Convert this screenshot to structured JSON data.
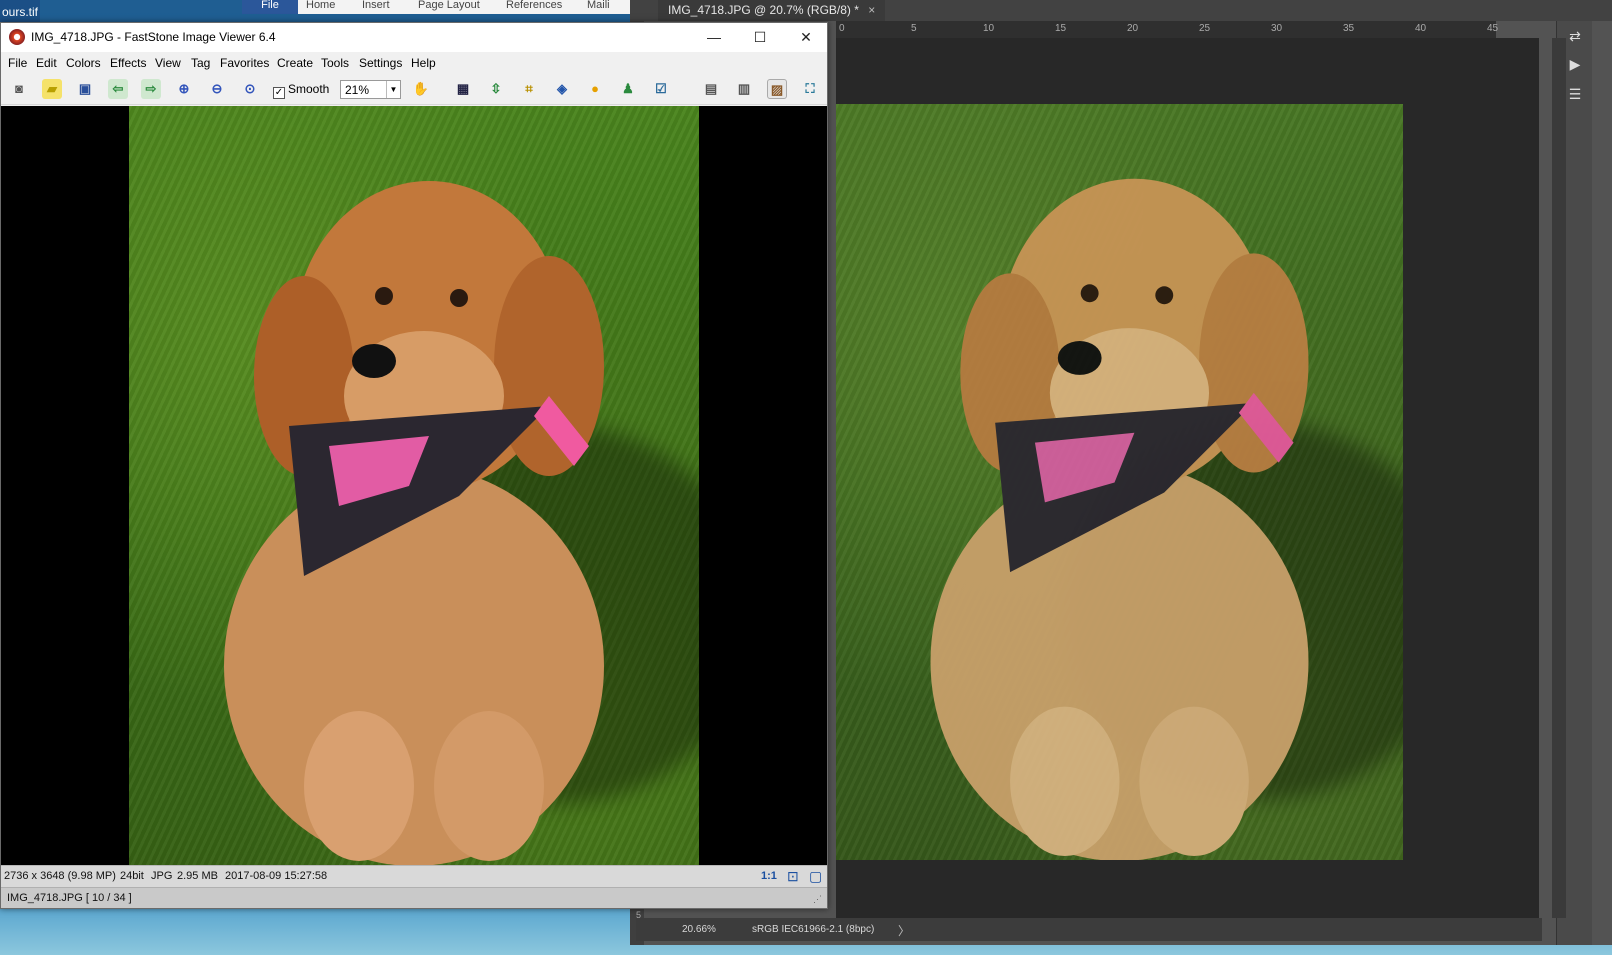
{
  "desktop": {
    "caption": "ours.tif"
  },
  "word": {
    "tabs": [
      "File",
      "Home",
      "Insert",
      "Page Layout",
      "References",
      "Maili"
    ]
  },
  "photoshop": {
    "doc_tab": "IMG_4718.JPG @ 20.7% (RGB/8) *",
    "close": "×",
    "ruler_ticks": [
      "0",
      "5",
      "10",
      "15",
      "20",
      "25",
      "30",
      "35",
      "40",
      "45"
    ],
    "left_ruler_mark": "5",
    "status_zoom": "20.66%",
    "status_profile": "sRGB IEC61966-2.1 (8bpc)",
    "status_arrow": "〉",
    "dock_icons": [
      "history-icon",
      "play-icon",
      "layer-comps-icon"
    ]
  },
  "faststone": {
    "title": "IMG_4718.JPG  -  FastStone Image Viewer 6.4",
    "window_buttons": {
      "minimize": "—",
      "maximize": "☐",
      "close": "✕"
    },
    "menu": [
      "File",
      "Edit",
      "Colors",
      "Effects",
      "View",
      "Tag",
      "Favorites",
      "Create",
      "Tools",
      "Settings",
      "Help"
    ],
    "smooth_label": "Smooth",
    "smooth_checked": "✓",
    "zoom_value": "21%",
    "status": {
      "dimensions": "2736 x 3648 (9.98 MP)",
      "bitdepth": "24bit",
      "format": "JPG",
      "filesize": "2.95 MB",
      "datetime": "2017-08-09 15:27:58",
      "ratio": "1:1",
      "filename": "IMG_4718.JPG [ 10 / 34 ]"
    }
  }
}
